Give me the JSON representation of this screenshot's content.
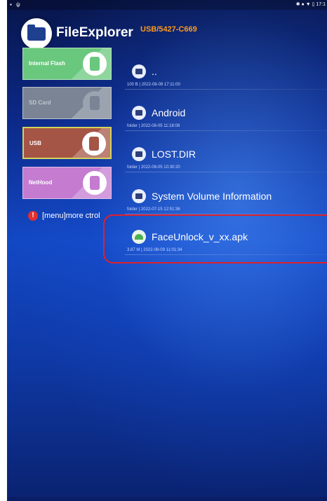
{
  "statusbar": {
    "left_icons": "▪ ψ",
    "right_text": "✱ ● ▼ ▯  17:1"
  },
  "header": {
    "app_title": "FileExplorer",
    "path": "USB/5427-C669"
  },
  "devices": [
    {
      "label": "Internal Flash",
      "icon": "chip-icon"
    },
    {
      "label": "SD Card",
      "icon": "sdcard-icon"
    },
    {
      "label": "USB",
      "icon": "usb-icon"
    },
    {
      "label": "NetHood",
      "icon": "network-icon"
    }
  ],
  "hint": {
    "icon": "!",
    "text": "[menu]more ctrol"
  },
  "files": [
    {
      "name": "..",
      "meta": "100 B | 2022-08-09 17:11:00",
      "type": "folder"
    },
    {
      "name": "Android",
      "meta": "folder | 2022-08-05 11:18:08",
      "type": "folder"
    },
    {
      "name": "LOST.DIR",
      "meta": "folder | 2022-08-05 10:30:20",
      "type": "folder"
    },
    {
      "name": "System Volume Information",
      "meta": "folder | 2022-07-15 12:51:36",
      "type": "folder"
    },
    {
      "name": "FaceUnlock_v_xx.apk",
      "meta": "3.87 M | 2022-08-09 11:01:34",
      "type": "apk"
    }
  ],
  "colors": {
    "accent_path": "#ff9a1a",
    "highlight": "#e0202a",
    "usb_selected_border": "#d4d45a"
  }
}
